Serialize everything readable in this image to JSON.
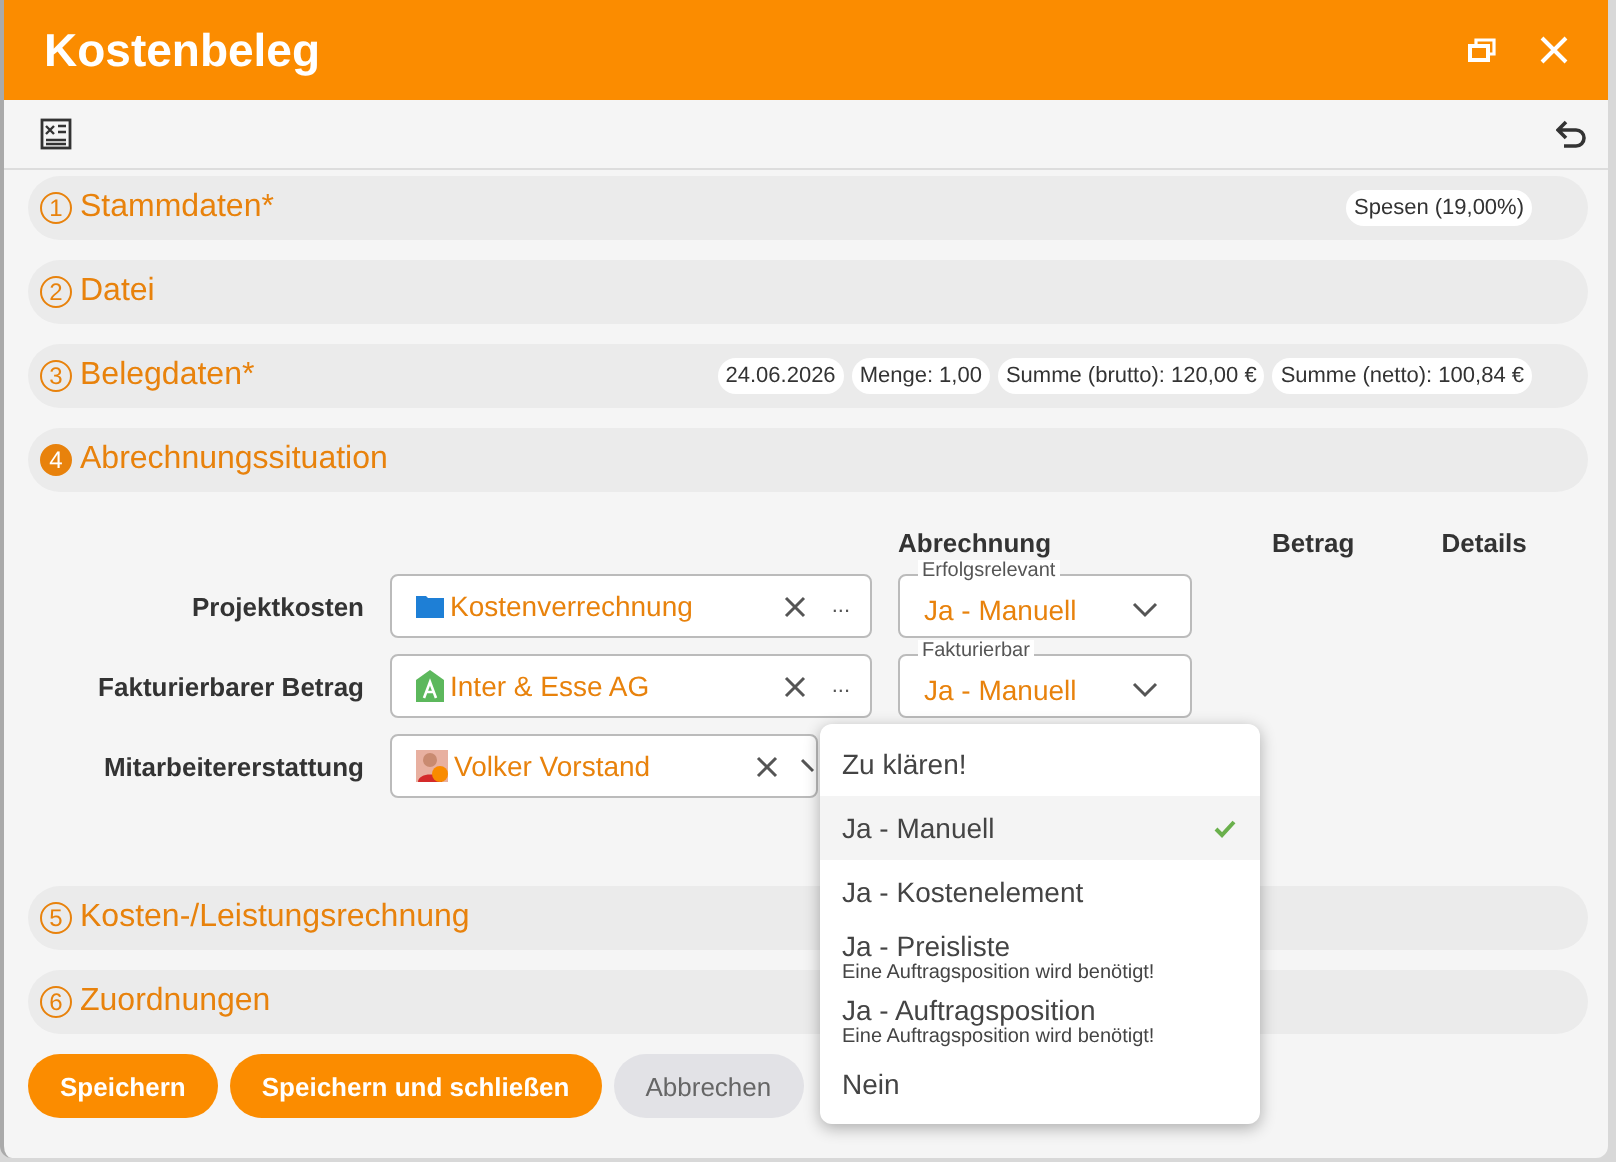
{
  "window": {
    "title": "Kostenbeleg"
  },
  "sections": [
    {
      "number": "1",
      "title": "Stammdaten*",
      "expanded": false,
      "chips": [
        "Spesen (19,00%)"
      ]
    },
    {
      "number": "2",
      "title": "Datei",
      "expanded": false
    },
    {
      "number": "3",
      "title": "Belegdaten*",
      "expanded": false,
      "chips": [
        "24.06.2026",
        "Menge: 1,00",
        "Summe (brutto): 120,00 €",
        "Summe (netto): 100,84 €"
      ]
    },
    {
      "number": "4",
      "title": "Abrechnungssituation",
      "expanded": true
    },
    {
      "number": "5",
      "title": "Kosten-/Leistungsrechnung",
      "expanded": false
    },
    {
      "number": "6",
      "title": "Zuordnungen",
      "expanded": false
    }
  ],
  "billing": {
    "columns": [
      "Abrechnung",
      "Betrag",
      "Details"
    ],
    "rows": [
      {
        "label": "Projektkosten",
        "kind": "folder",
        "value": "Kostenverrechnung",
        "more": "...",
        "select_label": "Erfolgsrelevant",
        "select_value": "Ja - Manuell"
      },
      {
        "label": "Fakturierbarer Betrag",
        "kind": "company",
        "value": "Inter & Esse AG",
        "more": "...",
        "select_label": "Fakturierbar",
        "select_value": "Ja - Manuell"
      },
      {
        "label": "Mitarbeitererstattung",
        "kind": "person",
        "value": "Volker Vorstand"
      }
    ]
  },
  "dropdown": [
    {
      "label": "Zu klären!",
      "selected": false
    },
    {
      "label": "Ja - Manuell",
      "selected": true
    },
    {
      "label": "Ja - Kostenelement",
      "selected": false
    },
    {
      "label": "Ja - Preisliste",
      "note": "Eine Auftragsposition wird benötigt!",
      "selected": false
    },
    {
      "label": "Ja - Auftragsposition",
      "note": "Eine Auftragsposition wird benötigt!",
      "selected": false
    },
    {
      "label": "Nein",
      "selected": false
    }
  ],
  "buttons": [
    {
      "label": "Speichern",
      "kind": "primary"
    },
    {
      "label": "Speichern und schließen",
      "kind": "primary"
    },
    {
      "label": "Abbrechen",
      "kind": "secondary"
    }
  ]
}
